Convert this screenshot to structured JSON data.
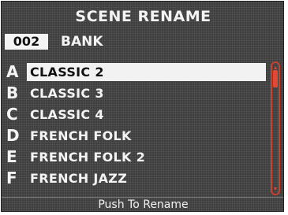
{
  "screen": {
    "title": "SCENE RENAME",
    "bank": {
      "number": "002",
      "label": "BANK"
    },
    "scenes": [
      {
        "letter": "A",
        "name": "CLASSIC 2",
        "selected": true
      },
      {
        "letter": "B",
        "name": "CLASSIC 3",
        "selected": false
      },
      {
        "letter": "C",
        "name": "CLASSIC 4",
        "selected": false
      },
      {
        "letter": "D",
        "name": "FRENCH FOLK",
        "selected": false
      },
      {
        "letter": "E",
        "name": "FRENCH FOLK 2",
        "selected": false
      },
      {
        "letter": "F",
        "name": "FRENCH JAZZ",
        "selected": false
      }
    ],
    "footer": "Push To Rename"
  },
  "colors": {
    "background": "#3a3a3a",
    "text": "#f4f4f4",
    "highlight": "#f2f2f2",
    "scrollbar": "#e04a34"
  }
}
